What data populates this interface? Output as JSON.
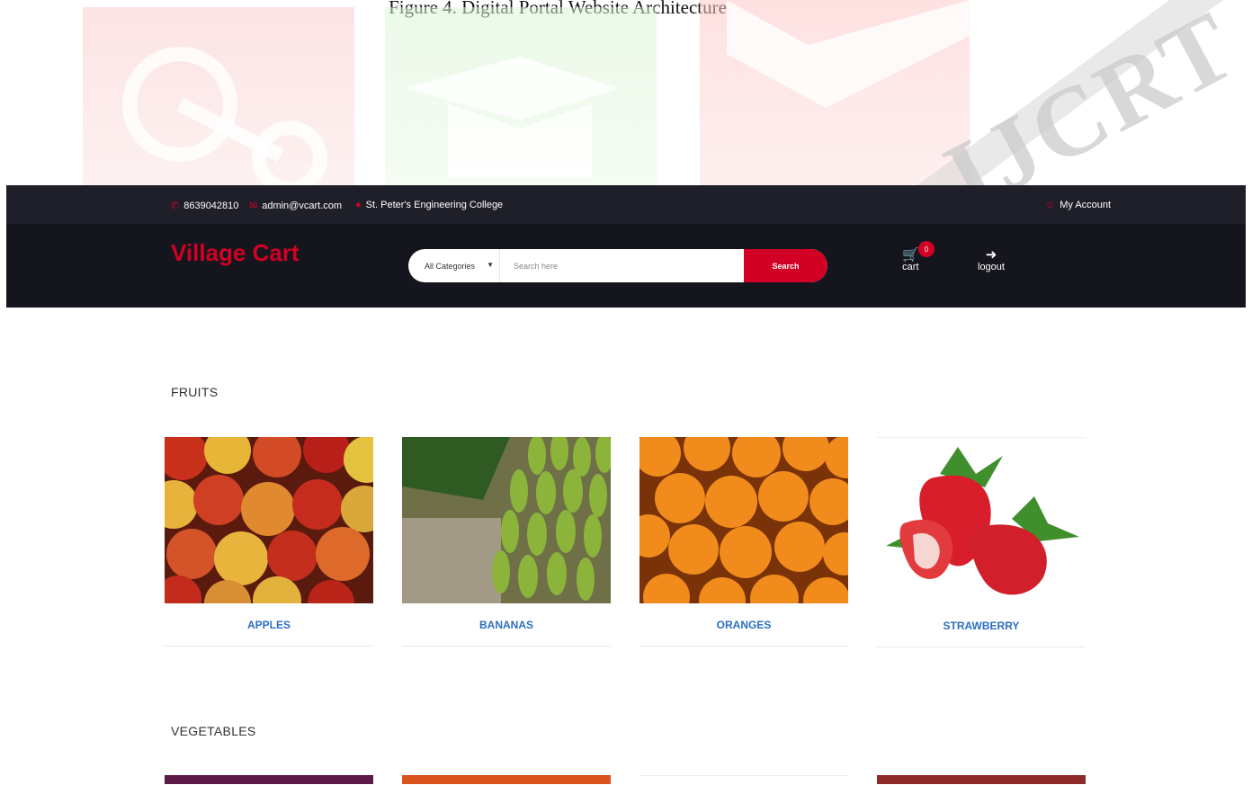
{
  "document": {
    "caption": "Figure 4. Digital Portal Website Architecture",
    "watermark": "IJCRT"
  },
  "header": {
    "phone": "8639042810",
    "email": "admin@vcart.com",
    "location": "St. Peter's Engineering College",
    "account": "My Account"
  },
  "brand": {
    "logo": "Village Cart",
    "accent": "#d10024"
  },
  "search": {
    "category": "All Categories",
    "placeholder": "Search here",
    "button": "Search"
  },
  "nav": {
    "cart_label": "cart",
    "cart_count": "0",
    "logout_label": "logout"
  },
  "sections": [
    {
      "title": "FRUITS",
      "products": [
        {
          "name": "APPLES"
        },
        {
          "name": "BANANAS"
        },
        {
          "name": "ORANGES"
        },
        {
          "name": "STRAWBERRY"
        }
      ]
    },
    {
      "title": "VEGETABLES"
    }
  ]
}
